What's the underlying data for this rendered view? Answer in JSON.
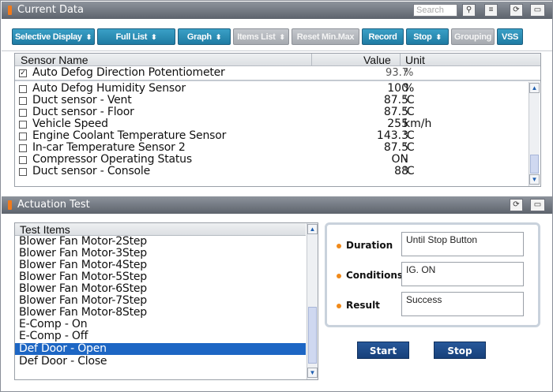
{
  "current_data": {
    "title": "Current Data",
    "search_placeholder": "Search",
    "icons": [
      "search-icon",
      "list-view-icon",
      "retry-icon",
      "window-icon"
    ]
  },
  "toolbar": {
    "selective_display": "Selective Display",
    "full_list": "Full List",
    "graph": "Graph",
    "items_list": "Items List",
    "reset_min_max": "Reset Min.Max",
    "record": "Record",
    "stop": "Stop",
    "grouping": "Grouping",
    "vss": "VSS",
    "dropdown_arrow": "⬍"
  },
  "sensor_table": {
    "headers": {
      "name": "Sensor Name",
      "value": "Value",
      "unit": "Unit"
    },
    "pinned": {
      "name": "Auto Defog Direction Potentiometer",
      "value": "93.7",
      "unit": "%",
      "checked": true
    },
    "rows": [
      {
        "name": "Auto Defog Humidity Sensor",
        "value": "100",
        "unit": "%"
      },
      {
        "name": "Duct sensor - Vent",
        "value": "87.5",
        "unit": "'C"
      },
      {
        "name": "Duct sensor - Floor",
        "value": "87.5",
        "unit": "'C"
      },
      {
        "name": "Vehicle Speed",
        "value": "255",
        "unit": "km/h"
      },
      {
        "name": "Engine Coolant Temperature Sensor",
        "value": "143.3",
        "unit": "'C"
      },
      {
        "name": "In-car Temperature Sensor 2",
        "value": "87.5",
        "unit": "'C"
      },
      {
        "name": "Compressor Operating Status",
        "value": "ON",
        "unit": "-"
      },
      {
        "name": "Duct sensor - Console",
        "value": "88",
        "unit": "'C"
      }
    ]
  },
  "actuation": {
    "title": "Actuation Test",
    "list_header": "Test Items",
    "items": [
      "Blower Fan Motor-2Step",
      "Blower Fan Motor-3Step",
      "Blower Fan Motor-4Step",
      "Blower Fan Motor-5Step",
      "Blower Fan Motor-6Step",
      "Blower Fan Motor-7Step",
      "Blower Fan Motor-8Step",
      "E-Comp - On",
      "E-Comp - Off",
      "Def Door - Open",
      "Def Door - Close"
    ],
    "selected_item": "Def Door - Open",
    "duration_label": "Duration",
    "duration_value": "Until Stop Button",
    "conditions_label": "Conditions",
    "conditions_value": "IG. ON",
    "result_label": "Result",
    "result_value": "Success",
    "start": "Start",
    "stop": "Stop"
  }
}
